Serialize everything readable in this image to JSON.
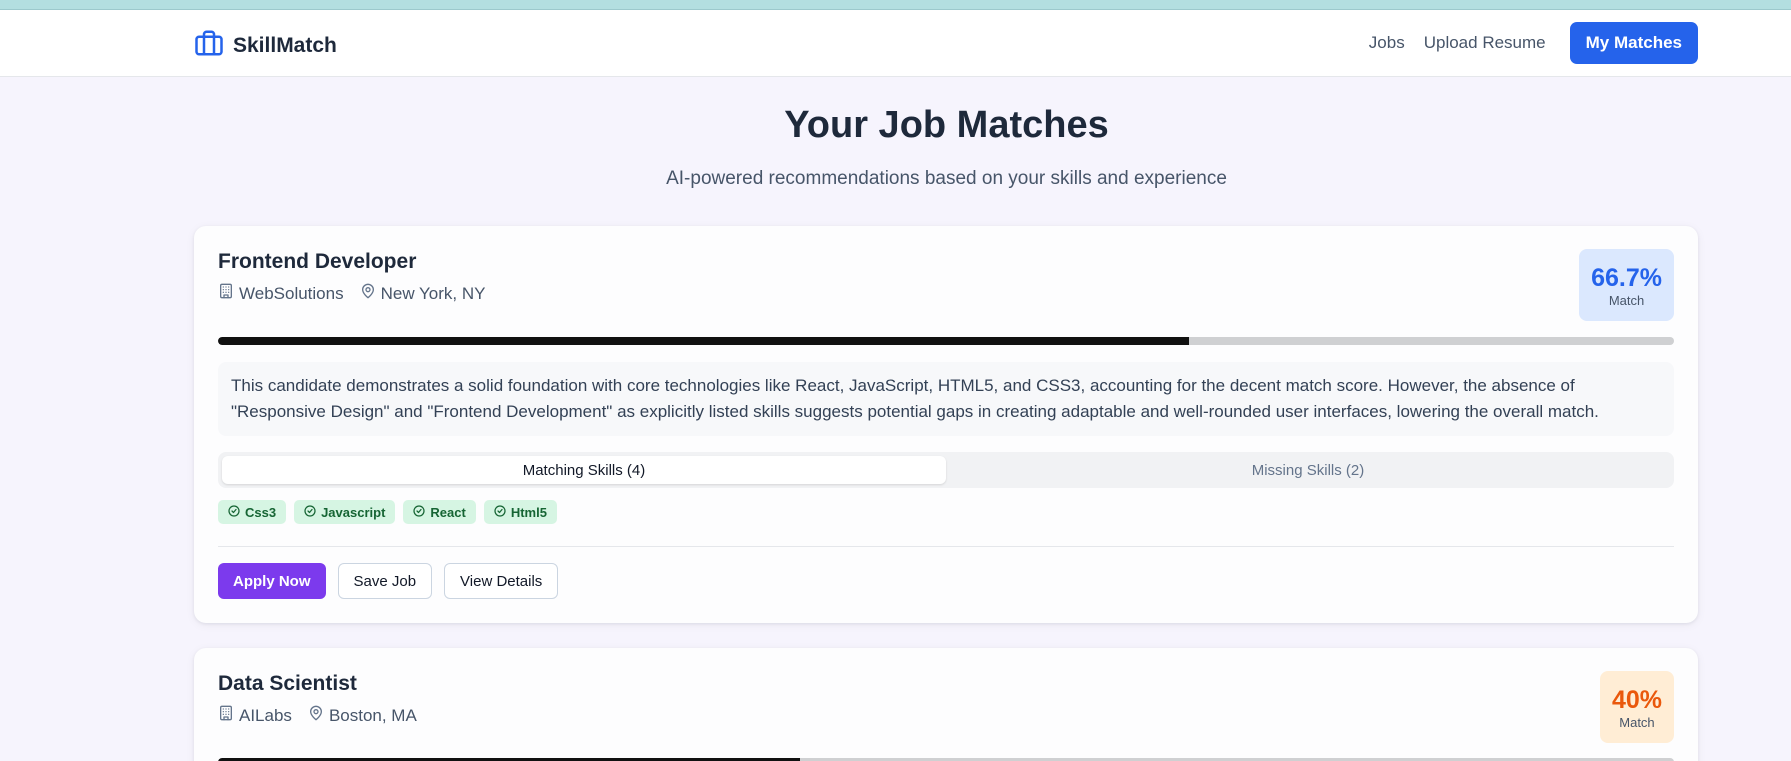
{
  "app": {
    "brand": "SkillMatch",
    "nav": {
      "jobs": "Jobs",
      "upload": "Upload Resume",
      "matches": "My Matches"
    }
  },
  "page": {
    "title": "Your Job Matches",
    "subtitle": "AI-powered recommendations based on your skills and experience"
  },
  "jobs": [
    {
      "title": "Frontend Developer",
      "company": "WebSolutions",
      "location": "New York, NY",
      "score": "66.7%",
      "score_label": "Match",
      "progress": 0.667,
      "summary": "This candidate demonstrates a solid foundation with core technologies like React, JavaScript, HTML5, and CSS3, accounting for the decent match score. However, the absence of \"Responsive Design\" and \"Frontend Development\" as explicitly listed skills suggests potential gaps in creating adaptable and well-rounded user interfaces, lowering the overall match.",
      "tabs": {
        "matching": "Matching Skills (4)",
        "missing": "Missing Skills (2)"
      },
      "skills": [
        "Css3",
        "Javascript",
        "React",
        "Html5"
      ],
      "actions": {
        "apply": "Apply Now",
        "save": "Save Job",
        "details": "View Details"
      }
    },
    {
      "title": "Data Scientist",
      "company": "AILabs",
      "location": "Boston, MA",
      "score": "40%",
      "score_label": "Match",
      "progress": 0.4
    }
  ],
  "colors": {
    "primary": "#2563eb",
    "apply": "#7c3aed",
    "score_high_bg": "#dbe8fe",
    "score_high_text": "#2563eb",
    "score_low_bg": "#ffedd5",
    "score_low_text": "#ea580c",
    "chip_bg": "#d6f5e3",
    "chip_text": "#166534"
  }
}
